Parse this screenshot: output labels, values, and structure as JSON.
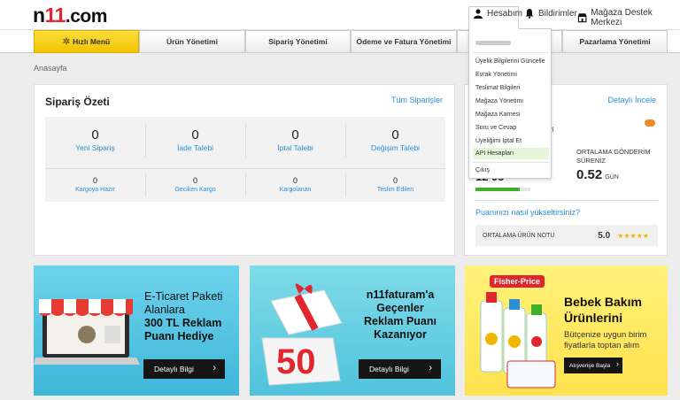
{
  "header": {
    "logo_main": "n",
    "logo_accent": "11",
    "logo_suffix": ".com",
    "account_label": "Hesabım",
    "notifications_label": "Bildirimler",
    "support_label": "Mağaza Destek Merkezi"
  },
  "menu": {
    "quick_label": "Hızlı Menü",
    "tabs": [
      "Ürün Yönetimi",
      "Sipariş Yönetimi",
      "Ödeme ve Fatura Yönetimi",
      "Pazarlama Yönetimi"
    ]
  },
  "breadcrumb": "Anasayfa",
  "order_summary": {
    "title": "Sipariş Özeti",
    "all_orders_link": "Tüm Siparişler",
    "top": [
      {
        "count": "0",
        "label": "Yeni Sipariş"
      },
      {
        "count": "0",
        "label": "İade Talebi"
      },
      {
        "count": "0",
        "label": "İptal Talebi"
      },
      {
        "count": "0",
        "label": "Değişim Talebi"
      }
    ],
    "bottom": [
      {
        "count": "0",
        "label": "Kargoya Hazır"
      },
      {
        "count": "0",
        "label": "Geciken Kargo"
      },
      {
        "count": "0",
        "label": "Kargolanan"
      },
      {
        "count": "0",
        "label": "Teslim Edilen"
      }
    ]
  },
  "store_panel": {
    "details_link": "Detaylı İncele",
    "shipping_label_1": "ORTALAMA GÖNDERİM",
    "shipping_label_2": "SÜRENİZ",
    "shipping_value": "0.52",
    "shipping_unit": "GÜN",
    "improve_link": "Puanınızı nasıl yükseltirsiniz?",
    "rating_label": "ORTALAMA ÜRÜN NOTU",
    "rating_value": "5.0",
    "stars": "★★★★★",
    "partial_left": "ri",
    "partial_left_2": "12 95",
    "progress": 0.8
  },
  "account_dropdown": {
    "items": [
      "Üyelik Bilgilerini Güncelle",
      "Evrak Yönetimi",
      "Teslimat Bilgileri",
      "Mağaza Yönetimi",
      "Mağaza Karnesi",
      "Soru ve Cevap",
      "Üyeliğimi İptal Et",
      "API Hesapları"
    ],
    "logout": "Çıkış",
    "active_index": 7
  },
  "banners": [
    {
      "line1": "E-Ticaret Paketi",
      "line2": "Alanlara",
      "line3": "300 TL Reklam",
      "line4": "Puanı Hediye",
      "cta": "Detaylı Bilgi"
    },
    {
      "line1": "n11faturam'a",
      "line2": "Geçenler",
      "line3": "Reklam Puanı",
      "line4": "Kazanıyor",
      "badge": "50",
      "cta": "Detaylı Bilgi"
    },
    {
      "brand": "Fisher-Price",
      "line1": "Bebek Bakım",
      "line2": "Ürünlerini",
      "sub1": "Bütçenize uygun birim",
      "sub2": "fiyatlarla toptan alım",
      "cta": "Alışverişe Başla"
    }
  ],
  "colors": {
    "accent_yellow": "#f2c500",
    "link_blue": "#2a8fd8",
    "brand_red": "#e3262e",
    "progress_green": "#3fae2a",
    "banner_teal": "#4fc3dc",
    "banner_yellow": "#ffe45c"
  }
}
